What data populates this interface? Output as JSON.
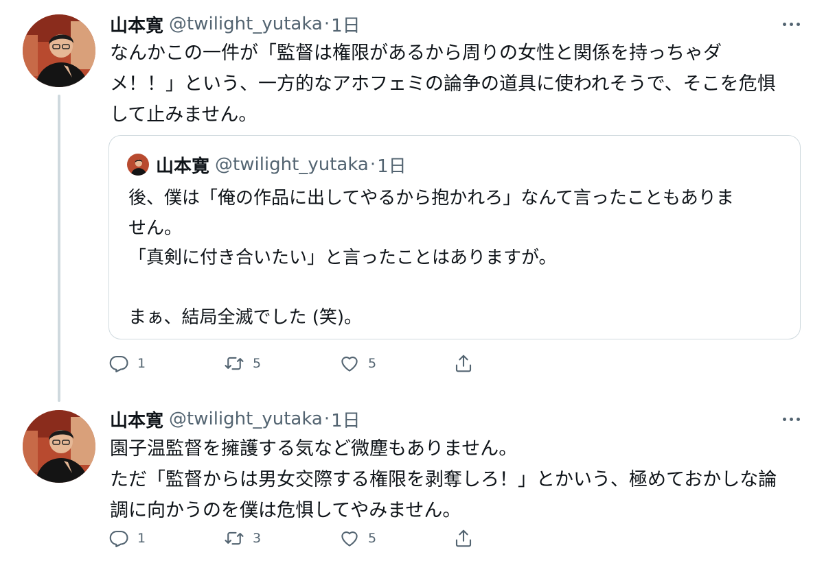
{
  "tweets": [
    {
      "author_name": "山本寛",
      "handle": "@twilight_yutaka",
      "separator": "·",
      "time": "1日",
      "text": "なんかこの一件が「監督は権限があるから周りの女性と関係を持っちゃダ\nメ！！」という、一方的なアホフェミの論争の道具に使われそうで、そこを危惧\nして止みません。",
      "quoted": {
        "author_name": "山本寛",
        "handle": "@twilight_yutaka",
        "separator": "·",
        "time": "1日",
        "text": "後、僕は「俺の作品に出してやるから抱かれろ」なんて言ったこともありま\nせん。\n「真剣に付き合いたい」と言ったことはありますが。\n\nまぁ、結局全滅でした (笑)。"
      },
      "reply_count": "1",
      "retweet_count": "5",
      "like_count": "5"
    },
    {
      "author_name": "山本寛",
      "handle": "@twilight_yutaka",
      "separator": "·",
      "time": "1日",
      "text": "園子温監督を擁護する気など微塵もありません。\nただ「監督からは男女交際する権限を剥奪しろ！」とかいう、極めておかしな論\n調に向かうのを僕は危惧してやみません。",
      "reply_count": "1",
      "retweet_count": "3",
      "like_count": "5"
    }
  ],
  "icons": {
    "reply": "reply-icon",
    "retweet": "retweet-icon",
    "like": "heart-icon",
    "share": "share-icon",
    "more": "more-options-icon"
  },
  "colors": {
    "text_primary": "#0f1419",
    "text_secondary": "#536471",
    "border": "#cfd9de"
  }
}
